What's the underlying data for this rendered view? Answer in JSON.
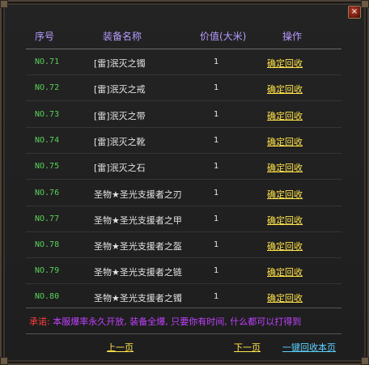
{
  "window": {
    "close_glyph": "×"
  },
  "headers": {
    "no": "序号",
    "name": "装备名称",
    "value": "价值(大米)",
    "operation": "操作"
  },
  "rows": [
    {
      "no": "NO.71",
      "name": "[雷]泯灭之镯",
      "value": "1",
      "action": "确定回收"
    },
    {
      "no": "NO.72",
      "name": "[雷]泯灭之戒",
      "value": "1",
      "action": "确定回收"
    },
    {
      "no": "NO.73",
      "name": "[雷]泯灭之带",
      "value": "1",
      "action": "确定回收"
    },
    {
      "no": "NO.74",
      "name": "[雷]泯灭之靴",
      "value": "1",
      "action": "确定回收"
    },
    {
      "no": "NO.75",
      "name": "[雷]泯灭之石",
      "value": "1",
      "action": "确定回收"
    },
    {
      "no": "NO.76",
      "name": "圣物★圣光支援者之刃",
      "value": "1",
      "action": "确定回收"
    },
    {
      "no": "NO.77",
      "name": "圣物★圣光支援者之甲",
      "value": "1",
      "action": "确定回收"
    },
    {
      "no": "NO.78",
      "name": "圣物★圣光支援者之盔",
      "value": "1",
      "action": "确定回收"
    },
    {
      "no": "NO.79",
      "name": "圣物★圣光支援者之链",
      "value": "1",
      "action": "确定回收"
    },
    {
      "no": "NO.80",
      "name": "圣物★圣光支援者之镯",
      "value": "1",
      "action": "确定回收"
    }
  ],
  "notice": {
    "label": "承诺:",
    "text": "本服爆率永久开放, 装备全爆, 只要你有时间, 什么都可以打得到"
  },
  "footer": {
    "prev": "上一页",
    "next": "下一页",
    "recycle_page": "一键回收本页"
  },
  "colors": {
    "header": "#b69cff",
    "row_no": "#5ad25a",
    "action": "#ffe34a",
    "notice_label": "#ff3b3b",
    "notice_text": "#c040ff",
    "recycle_page": "#5bd3ff"
  }
}
